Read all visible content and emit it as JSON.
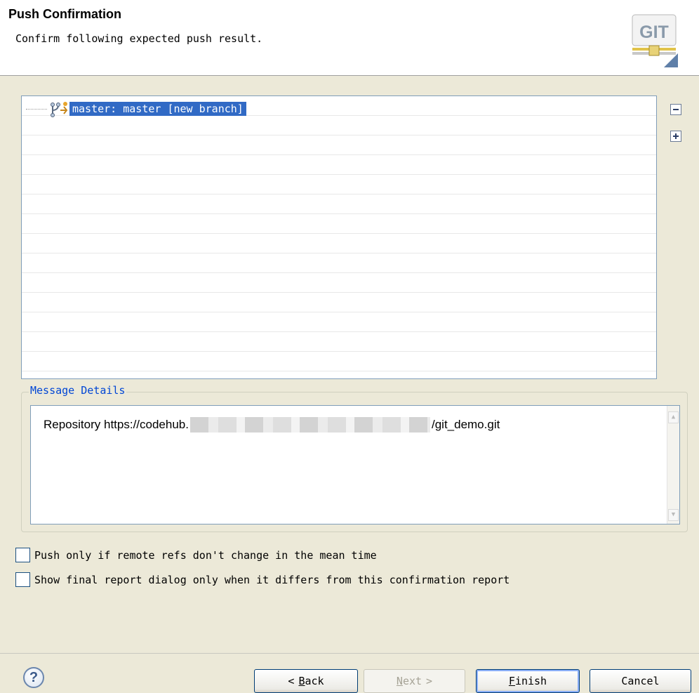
{
  "header": {
    "title": "Push Confirmation",
    "subtitle": "Confirm following expected push result.",
    "logo_text": "GIT"
  },
  "tree": {
    "items": [
      {
        "label": "master: master [new branch]",
        "selected": true,
        "icon": "branch-push-icon"
      }
    ],
    "collapse_icon": "collapse-all-icon",
    "expand_icon": "expand-all-icon"
  },
  "message_details": {
    "title": "Message Details",
    "label": "Repository",
    "url_prefix": "https://codehub.",
    "url_suffix": "/git_demo.git"
  },
  "options": {
    "push_if_unchanged": {
      "label": "Push only if remote refs don't change in the mean time",
      "checked": false
    },
    "show_final_report": {
      "label": "Show final report dialog only when it differs from this confirmation report",
      "checked": false
    }
  },
  "footer": {
    "help": "?",
    "back": {
      "arrow": "<",
      "key": "B",
      "rest": "ack"
    },
    "next": {
      "key": "N",
      "rest": "ext",
      "arrow": ">"
    },
    "finish": {
      "key": "F",
      "rest": "inish"
    },
    "cancel": "Cancel"
  },
  "colors": {
    "selection": "#316ac5",
    "group_title": "#0046d5",
    "dialog_bg": "#ece9d8"
  }
}
